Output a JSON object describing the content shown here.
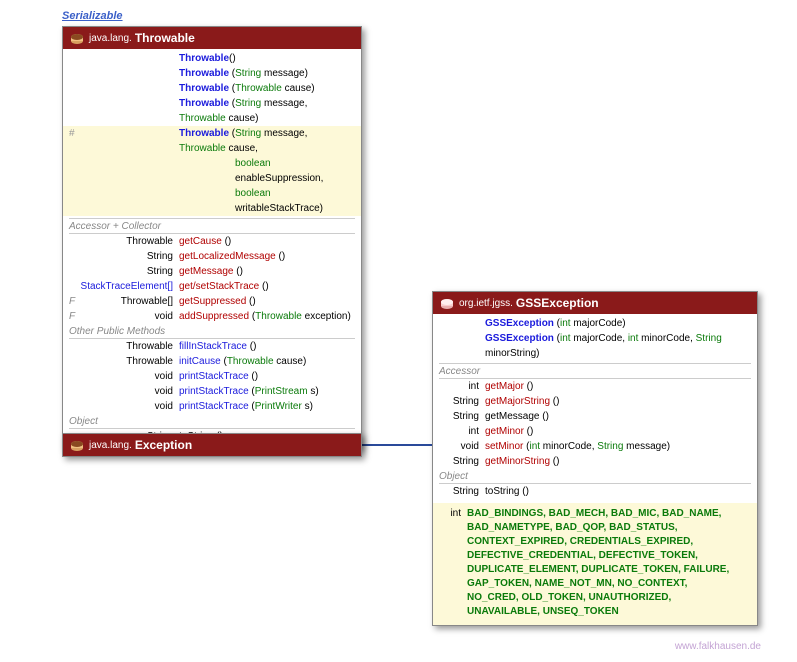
{
  "serializable": "Serializable",
  "throwable": {
    "pkg": "java.lang.",
    "name": "Throwable",
    "constructors": [
      {
        "mod": "",
        "name": "Throwable",
        "params": "()"
      },
      {
        "mod": "",
        "name": "Throwable",
        "params_pre": " (",
        "type1": "String",
        "rest1": " message)"
      },
      {
        "mod": "",
        "name": "Throwable",
        "params_pre": " (",
        "type1": "Throwable",
        "rest1": " cause)"
      },
      {
        "mod": "",
        "name": "Throwable",
        "params_pre": " (",
        "type1": "String",
        "mid1": " message, ",
        "type2": "Throwable",
        "rest2": " cause)"
      }
    ],
    "protected": {
      "mod": "#",
      "name": "Throwable",
      "pre": " (",
      "t1": "String",
      "m1": " message, ",
      "t2": "Throwable",
      "m2": " cause,",
      "line2_t": "boolean",
      "line2_r": " enableSuppression,",
      "line3_t": "boolean",
      "line3_r": " writableStackTrace)"
    },
    "section1": "Accessor + Collector",
    "accessors": [
      {
        "ret": "Throwable",
        "name": "getCause",
        "rest": " ()"
      },
      {
        "ret": "String",
        "name": "getLocalizedMessage",
        "rest": " ()"
      },
      {
        "ret": "String",
        "name": "getMessage",
        "rest": " ()"
      },
      {
        "ret": "StackTraceElement[]",
        "name": "get/setStackTrace",
        "rest": " ()"
      },
      {
        "mod": "F",
        "ret": "Throwable[]",
        "name": "getSuppressed",
        "rest": " ()"
      },
      {
        "mod": "F",
        "ret": "void",
        "name": "addSuppressed",
        "pre": " (",
        "ptype": "Throwable",
        "prest": " exception)"
      }
    ],
    "section2": "Other Public Methods",
    "others": [
      {
        "ret": "Throwable",
        "name": "fillInStackTrace",
        "rest": " ()"
      },
      {
        "ret": "Throwable",
        "name": "initCause",
        "pre": " (",
        "ptype": "Throwable",
        "prest": " cause)"
      },
      {
        "ret": "void",
        "name": "printStackTrace",
        "rest": " ()"
      },
      {
        "ret": "void",
        "name": "printStackTrace",
        "pre": " (",
        "ptype": "PrintStream",
        "prest": " s)"
      },
      {
        "ret": "void",
        "name": "printStackTrace",
        "pre": " (",
        "ptype": "PrintWriter",
        "prest": " s)"
      }
    ],
    "section3": "Object",
    "tostring_ret": "String",
    "tostring": "toString",
    "tostring_rest": " ()"
  },
  "exception": {
    "pkg": "java.lang.",
    "name": "Exception"
  },
  "gss": {
    "pkg": "org.ietf.jgss.",
    "name": "GSSException",
    "constructors": [
      {
        "name": "GSSException",
        "pre": " (",
        "t1": "int",
        "r1": " majorCode)"
      },
      {
        "name": "GSSException",
        "pre": " (",
        "t1": "int",
        "m1": " majorCode, ",
        "t2": "int",
        "m2": " minorCode, ",
        "t3": "String",
        "r3": " minorString)"
      }
    ],
    "section1": "Accessor",
    "accessors": [
      {
        "ret": "int",
        "name": "getMajor",
        "rest": " ()"
      },
      {
        "ret": "String",
        "name": "getMajorString",
        "rest": " ()"
      },
      {
        "ret": "String",
        "name_black": "getMessage",
        "rest": " ()"
      },
      {
        "ret": "int",
        "name": "getMinor",
        "rest": " ()"
      },
      {
        "ret": "void",
        "name": "setMinor",
        "pre": " (",
        "t1": "int",
        "m1": " minorCode, ",
        "t2": "String",
        "r2": " message)"
      },
      {
        "ret": "String",
        "name": "getMinorString",
        "rest": " ()"
      }
    ],
    "section2": "Object",
    "tostring_ret": "String",
    "tostring": "toString",
    "tostring_rest": " ()",
    "const_ret": "int",
    "constants": "BAD_BINDINGS, BAD_MECH, BAD_MIC, BAD_NAME, BAD_NAMETYPE, BAD_QOP, BAD_STATUS, CONTEXT_EXPIRED, CREDENTIALS_EXPIRED, DEFECTIVE_CREDENTIAL, DEFECTIVE_TOKEN, DUPLICATE_ELEMENT, DUPLICATE_TOKEN, FAILURE, GAP_TOKEN, NAME_NOT_MN, NO_CONTEXT, NO_CRED, OLD_TOKEN, UNAUTHORIZED, UNAVAILABLE, UNSEQ_TOKEN"
  },
  "footer": "www.falkhausen.de"
}
